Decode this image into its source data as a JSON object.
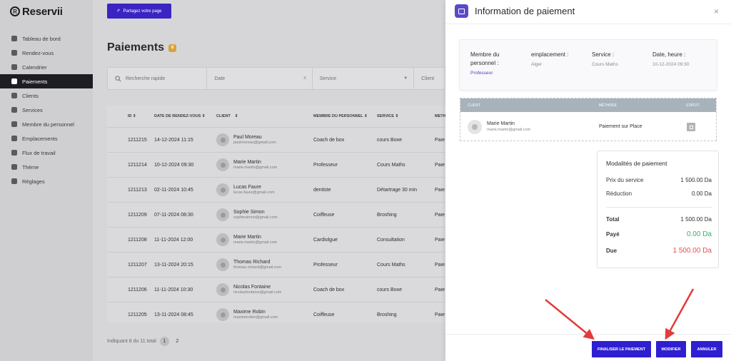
{
  "app": {
    "brand": "Reservii",
    "brand_mark": "R",
    "share_button": "Partagez votre page",
    "sidebar": [
      {
        "label": "Tableau de bord",
        "icon": "dashboard-icon"
      },
      {
        "label": "Rendez-vous",
        "icon": "clock-icon"
      },
      {
        "label": "Calendrier",
        "icon": "calendar-icon"
      },
      {
        "label": "Paiements",
        "icon": "wallet-icon",
        "active": true
      },
      {
        "label": "Clients",
        "icon": "users-icon"
      },
      {
        "label": "Services",
        "icon": "list-icon"
      },
      {
        "label": "Membre du personnel",
        "icon": "user-icon"
      },
      {
        "label": "Emplacements",
        "icon": "location-icon"
      },
      {
        "label": "Flux de travail",
        "icon": "workflow-icon"
      },
      {
        "label": "Thème",
        "icon": "brush-icon"
      },
      {
        "label": "Réglages",
        "icon": "gear-icon"
      }
    ],
    "page_title": "Paiements",
    "page_count": "8",
    "filters": {
      "search_placeholder": "Recherche rapide",
      "date": "Date",
      "service": "Service",
      "client": "Client"
    },
    "table": {
      "headers": [
        "ID",
        "DATE DE RENDEZ-VOUS",
        "CLIENT",
        "MEMBRE DU PERSONNEL",
        "SERVICE",
        "METH"
      ],
      "rows": [
        {
          "id": "1211215",
          "date": "14-12-2024 11:15",
          "name": "Paul Moreau",
          "email": "paulmoreau@gmail.com",
          "staff": "Coach de box",
          "service": "cours Boxe",
          "method": "Paie"
        },
        {
          "id": "1211214",
          "date": "10-12-2024 09:30",
          "name": "Marie Martin",
          "email": "marie.martin@gmail.com",
          "staff": "Professeur",
          "service": "Cours Maths",
          "method": "Paie"
        },
        {
          "id": "1211213",
          "date": "02-11-2024 10:45",
          "name": "Lucas Faure",
          "email": "lucas.faure@gmail.com",
          "staff": "dentiste",
          "service": "Détartrage 30 min",
          "method": "Paie"
        },
        {
          "id": "1211209",
          "date": "07-11-2024 08:30",
          "name": "Sophie Simon",
          "email": "sophiesimon@gmail.com",
          "staff": "Coiffeuse",
          "service": "Broshing",
          "method": "Paie"
        },
        {
          "id": "1211208",
          "date": "11-11-2024 12:00",
          "name": "Marie Martin",
          "email": "marie.martin@gmail.com",
          "staff": "Cardiolgue",
          "service": "Consultation",
          "method": "Paie"
        },
        {
          "id": "1211207",
          "date": "13-11-2024 20:15",
          "name": "Thomas Richard",
          "email": "thomas.richard@gmail.com",
          "staff": "Professeur",
          "service": "Cours Maths",
          "method": "Paie"
        },
        {
          "id": "1211206",
          "date": "11-11-2024 10:30",
          "name": "Nicolas Fontaine",
          "email": "nicolasfontaine@gmail.com",
          "staff": "Coach de box",
          "service": "cours Boxe",
          "method": "Paie"
        },
        {
          "id": "1211205",
          "date": "13-11-2024 08:45",
          "name": "Maxime Robin",
          "email": "maximerobin@gmail.com",
          "staff": "Coiffeuse",
          "service": "Broshing",
          "method": "Paie"
        }
      ]
    },
    "pager": {
      "text": "Indiquant 8 du 11 total",
      "pages": [
        "1",
        "2"
      ]
    }
  },
  "panel": {
    "title": "Information de paiement",
    "close": "×",
    "info": {
      "staff_label": "Membre du personnel :",
      "staff_value": "Professeur",
      "location_label": "emplacement :",
      "location_value": "Alger",
      "service_label": "Service :",
      "service_value": "Cours Maths",
      "datetime_label": "Date, heure :",
      "datetime_value": "10-12-2024 09:30"
    },
    "client_table": {
      "h_client": "Client",
      "h_method": "Méthode",
      "h_status": "Statut",
      "name": "Marie Martin",
      "email": "marie.martin@gmail.com",
      "method": "Paiement sur Place"
    },
    "payment": {
      "title": "Modalités de paiement",
      "price_label": "Prix du service",
      "price_value": "1 500.00 Da",
      "discount_label": "Réduction",
      "discount_value": "0.00 Da",
      "total_label": "Total",
      "total_value": "1 500.00 Da",
      "paid_label": "Payé",
      "paid_value": "0.00 Da",
      "due_label": "Due",
      "due_value": "1 500.00 Da"
    },
    "buttons": {
      "finalize": "Finaliser le paiement",
      "modify": "Modifier",
      "cancel": "Annuler"
    }
  },
  "colors": {
    "accent": "#2f1fd0",
    "paid": "#2bb46a",
    "due": "#e15050",
    "arrow": "#e33b3b"
  }
}
